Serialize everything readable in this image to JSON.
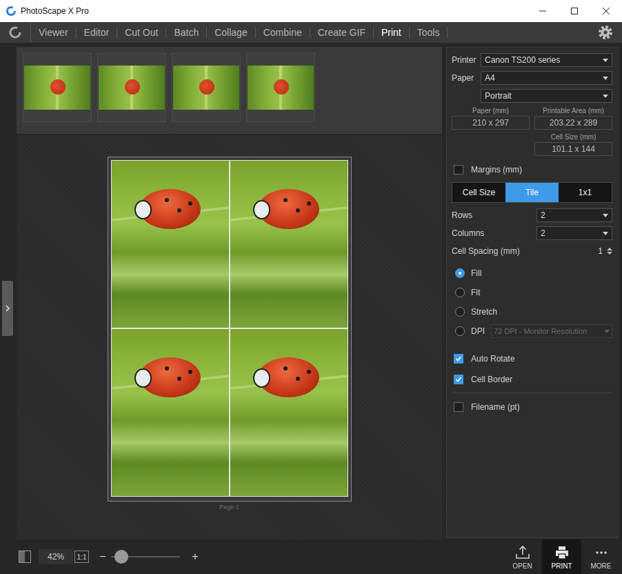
{
  "window": {
    "title": "PhotoScape X Pro"
  },
  "menu": {
    "tabs": [
      {
        "label": "Viewer",
        "selected": false
      },
      {
        "label": "Editor",
        "selected": false
      },
      {
        "label": "Cut Out",
        "selected": false
      },
      {
        "label": "Batch",
        "selected": false
      },
      {
        "label": "Collage",
        "selected": false
      },
      {
        "label": "Combine",
        "selected": false
      },
      {
        "label": "Create GIF",
        "selected": false
      },
      {
        "label": "Print",
        "selected": true
      },
      {
        "label": "Tools",
        "selected": false
      }
    ]
  },
  "thumbnails": [
    {
      "selected": false
    },
    {
      "selected": false
    },
    {
      "selected": false
    },
    {
      "selected": false
    }
  ],
  "preview": {
    "page_label": "Page 1"
  },
  "settings": {
    "printer": {
      "label": "Printer",
      "value": "Canon TS200 series"
    },
    "paper": {
      "label": "Paper",
      "value": "A4",
      "orientation": "Portrait"
    },
    "paper_size": {
      "label": "Paper (mm)",
      "value": "210 x 297"
    },
    "printable_area": {
      "label": "Printable Area (mm)",
      "value": "203.22 x 289"
    },
    "cell_size": {
      "label": "Cell Size (mm)",
      "value": "101.1 x 144"
    },
    "margins": {
      "label": "Margins (mm)",
      "checked": false
    },
    "modes": [
      {
        "label": "Cell Size",
        "selected": false
      },
      {
        "label": "Tile",
        "selected": true
      },
      {
        "label": "1x1",
        "selected": false
      }
    ],
    "rows": {
      "label": "Rows",
      "value": "2"
    },
    "columns": {
      "label": "Columns",
      "value": "2"
    },
    "cell_spacing": {
      "label": "Cell Spacing (mm)",
      "value": "1"
    },
    "fit_options": [
      {
        "label": "Fill",
        "selected": true,
        "kind": "radio"
      },
      {
        "label": "Fit",
        "selected": false,
        "kind": "radio"
      },
      {
        "label": "Stretch",
        "selected": false,
        "kind": "radio"
      },
      {
        "label": "DPI",
        "selected": false,
        "kind": "dropdown",
        "dropdown": {
          "value": "72 DPI - Monitor Resolution",
          "disabled": true
        }
      }
    ],
    "options": [
      {
        "label": "Auto Rotate",
        "checked": true
      },
      {
        "label": "Cell Border",
        "checked": true
      }
    ],
    "filename": {
      "label": "Filename (pt)",
      "checked": false
    }
  },
  "bottom_bar": {
    "zoom": "42%",
    "actual_size": "1:1",
    "zoom_out": "−",
    "zoom_in": "+",
    "slider": {
      "level": 0.15
    },
    "actions": [
      {
        "label": "OPEN",
        "selected": false
      },
      {
        "label": "PRINT",
        "selected": true
      },
      {
        "label": "MORE",
        "selected": false
      }
    ]
  }
}
